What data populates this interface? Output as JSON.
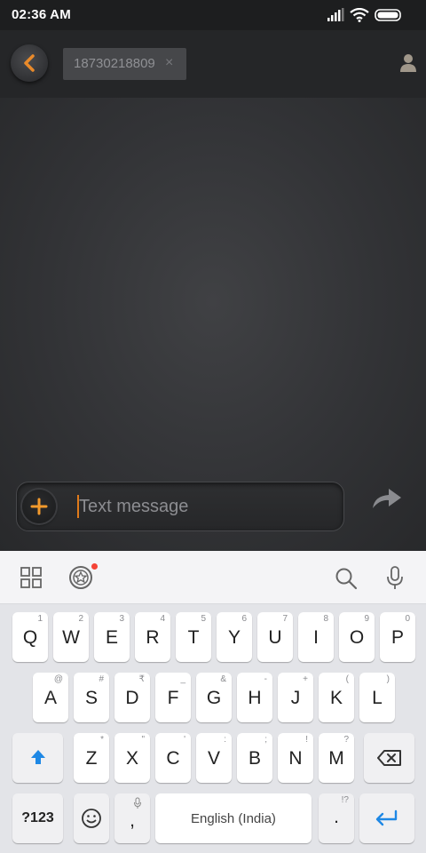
{
  "status_bar": {
    "time": "02:36 AM",
    "icons": [
      "signal-icon",
      "wifi-icon",
      "battery-icon"
    ]
  },
  "header": {
    "back_icon": "chevron-left-icon",
    "recipient": "18730218809",
    "recipient_remove": "×",
    "contacts_icon": "person-icon"
  },
  "composer": {
    "placeholder": "Text message",
    "attach_icon": "plus-icon",
    "send_icon": "send-arrow-icon"
  },
  "keyboard_toolbar": {
    "items": [
      "grid-icon",
      "sticker-icon",
      "search-icon",
      "mic-icon"
    ]
  },
  "keyboard": {
    "row1": [
      {
        "key": "Q",
        "hint": "1"
      },
      {
        "key": "W",
        "hint": "2"
      },
      {
        "key": "E",
        "hint": "3"
      },
      {
        "key": "R",
        "hint": "4"
      },
      {
        "key": "T",
        "hint": "5"
      },
      {
        "key": "Y",
        "hint": "6"
      },
      {
        "key": "U",
        "hint": "7"
      },
      {
        "key": "I",
        "hint": "8"
      },
      {
        "key": "O",
        "hint": "9"
      },
      {
        "key": "P",
        "hint": "0"
      }
    ],
    "row2": [
      {
        "key": "A",
        "hint": "@"
      },
      {
        "key": "S",
        "hint": "#"
      },
      {
        "key": "D",
        "hint": "₹"
      },
      {
        "key": "F",
        "hint": "_"
      },
      {
        "key": "G",
        "hint": "&"
      },
      {
        "key": "H",
        "hint": "-"
      },
      {
        "key": "J",
        "hint": "+"
      },
      {
        "key": "K",
        "hint": "("
      },
      {
        "key": "L",
        "hint": ")"
      }
    ],
    "row3": [
      {
        "key": "Z",
        "hint": "*"
      },
      {
        "key": "X",
        "hint": "\""
      },
      {
        "key": "C",
        "hint": "'"
      },
      {
        "key": "V",
        "hint": ":"
      },
      {
        "key": "B",
        "hint": ";"
      },
      {
        "key": "N",
        "hint": "!"
      },
      {
        "key": "M",
        "hint": "?"
      }
    ],
    "symbols_label": "?123",
    "comma": ",",
    "space_label": "English (India)",
    "period": ".",
    "period_hint": "!?",
    "accent_color": "#1e88e5"
  }
}
